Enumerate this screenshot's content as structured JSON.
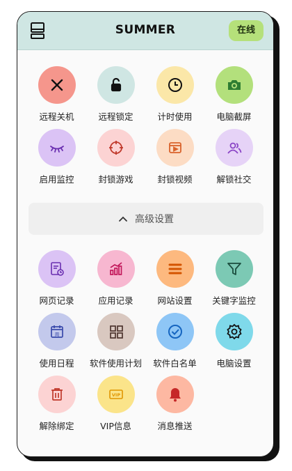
{
  "header": {
    "title": "SUMMER",
    "status": "在线",
    "device_icon": "computer-icon"
  },
  "quick_actions": [
    {
      "label": "远程关机",
      "icon": "close-icon",
      "color": "#f5968c"
    },
    {
      "label": "远程锁定",
      "icon": "unlock-icon",
      "color": "#cfe6e3"
    },
    {
      "label": "计时使用",
      "icon": "clock-icon",
      "color": "#fbe7a8"
    },
    {
      "label": "电脑截屏",
      "icon": "camera-icon",
      "color": "#b3e07c"
    },
    {
      "label": "启用监控",
      "icon": "eye-icon",
      "color": "#dbc3f5"
    },
    {
      "label": "封锁游戏",
      "icon": "target-icon",
      "color": "#fcd3d3"
    },
    {
      "label": "封锁视频",
      "icon": "video-icon",
      "color": "#fcdcc4"
    },
    {
      "label": "解锁社交",
      "icon": "users-icon",
      "color": "#e6d3f7"
    }
  ],
  "advanced": {
    "label": "高级设置",
    "icon": "chevron-up-icon"
  },
  "advanced_items": [
    {
      "label": "网页记录",
      "icon": "web-log-icon",
      "color": "#dbc3f5"
    },
    {
      "label": "应用记录",
      "icon": "chart-icon",
      "color": "#f7b7d0"
    },
    {
      "label": "网站设置",
      "icon": "menu-icon",
      "color": "#fdb97f"
    },
    {
      "label": "关键字监控",
      "icon": "filter-icon",
      "color": "#7cc9b4"
    },
    {
      "label": "使用日程",
      "icon": "calendar-icon",
      "color": "#c3c9ec"
    },
    {
      "label": "软件使用计划",
      "icon": "apps-icon",
      "color": "#d9c8c0"
    },
    {
      "label": "软件白名单",
      "icon": "check-icon",
      "color": "#8ec6f6"
    },
    {
      "label": "电脑设置",
      "icon": "gear-icon",
      "color": "#7fd9ea"
    },
    {
      "label": "解除绑定",
      "icon": "trash-icon",
      "color": "#fcd3d3"
    },
    {
      "label": "VIP信息",
      "icon": "vip-icon",
      "color": "#fbe48a"
    },
    {
      "label": "消息推送",
      "icon": "bell-icon",
      "color": "#fdb8a2"
    }
  ]
}
